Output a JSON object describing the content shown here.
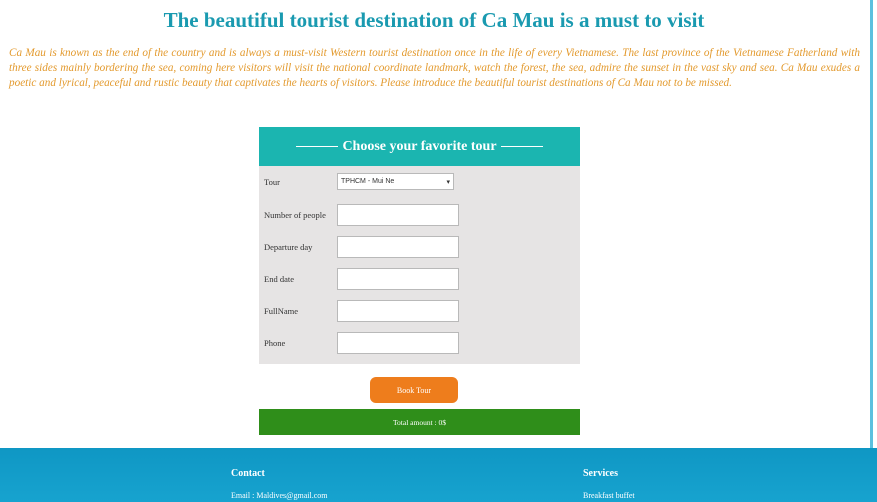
{
  "page": {
    "title": "The beautiful tourist destination of Ca Mau is a must to visit",
    "intro": "Ca Mau is known as the end of the country and is always a must-visit Western tourist destination once in the life of every Vietnamese. The last province of the Vietnamese Fatherland with three sides mainly bordering the sea, coming here visitors will visit the national coordinate landmark, watch the forest, the sea, admire the sunset in the vast sky and sea. Ca Mau exudes a poetic and lyrical, peaceful and rustic beauty that captivates the hearts of visitors. Please introduce the beautiful tourist destinations of Ca Mau not to be missed."
  },
  "form": {
    "header": "Choose your favorite tour",
    "tour_label": "Tour",
    "tour_selected": "TPHCM - Mui Ne",
    "people_label": "Number of people",
    "departure_label": "Departure day",
    "end_label": "End date",
    "fullname_label": "FullName",
    "phone_label": "Phone",
    "book_button": "Book Tour",
    "total": "Total amount : 0$"
  },
  "footer": {
    "contact_title": "Contact",
    "contact_email": "Email : Maldives@gmail.com",
    "services_title": "Services",
    "services_item": "Breakfast buffet"
  },
  "colors": {
    "title": "#1a9ab0",
    "intro": "#e39a2e",
    "form_header": "#1bb5b0",
    "book_button": "#ee7d1c",
    "total_bar": "#2f8e1a",
    "footer": "#0f97c4"
  }
}
